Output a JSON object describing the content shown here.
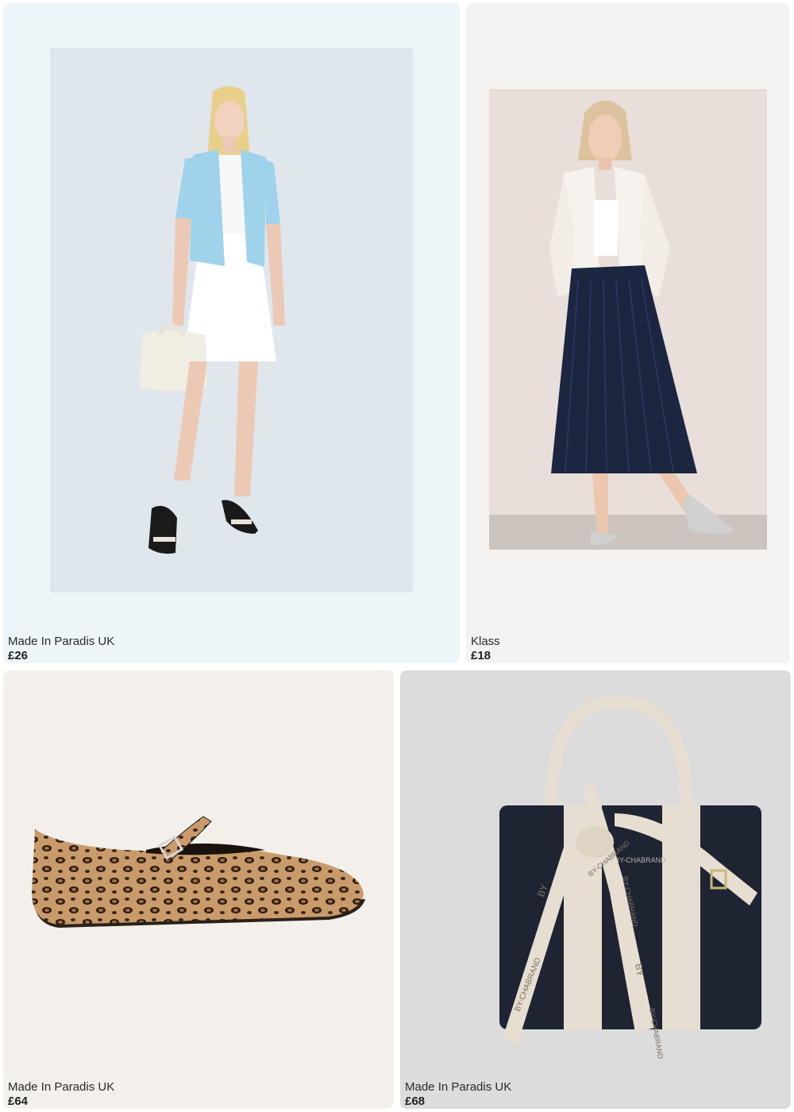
{
  "products": [
    {
      "brand": "Made In Paradis UK",
      "price": "£26"
    },
    {
      "brand": "Klass",
      "price": "£18"
    },
    {
      "brand": "Made In Paradis UK",
      "price": "£64"
    },
    {
      "brand": "Made In Paradis UK",
      "price": "£68"
    }
  ],
  "colors": {
    "card1_bg": "#eef5f8",
    "card2_bg": "#f5f3f1",
    "card3_bg": "#f3efea",
    "card4_bg": "#dcdcdc",
    "cardigan_blue": "#9fd3ec",
    "skirt_navy": "#1d2640",
    "bag_navy": "#1f2433",
    "bag_cream": "#e6ded0"
  },
  "strap_print": [
    "BY",
    "BY-CHABRAND",
    "BY",
    "BY-CHABRAND",
    "BY-CHABRAND",
    "BY-CHABRAND"
  ]
}
